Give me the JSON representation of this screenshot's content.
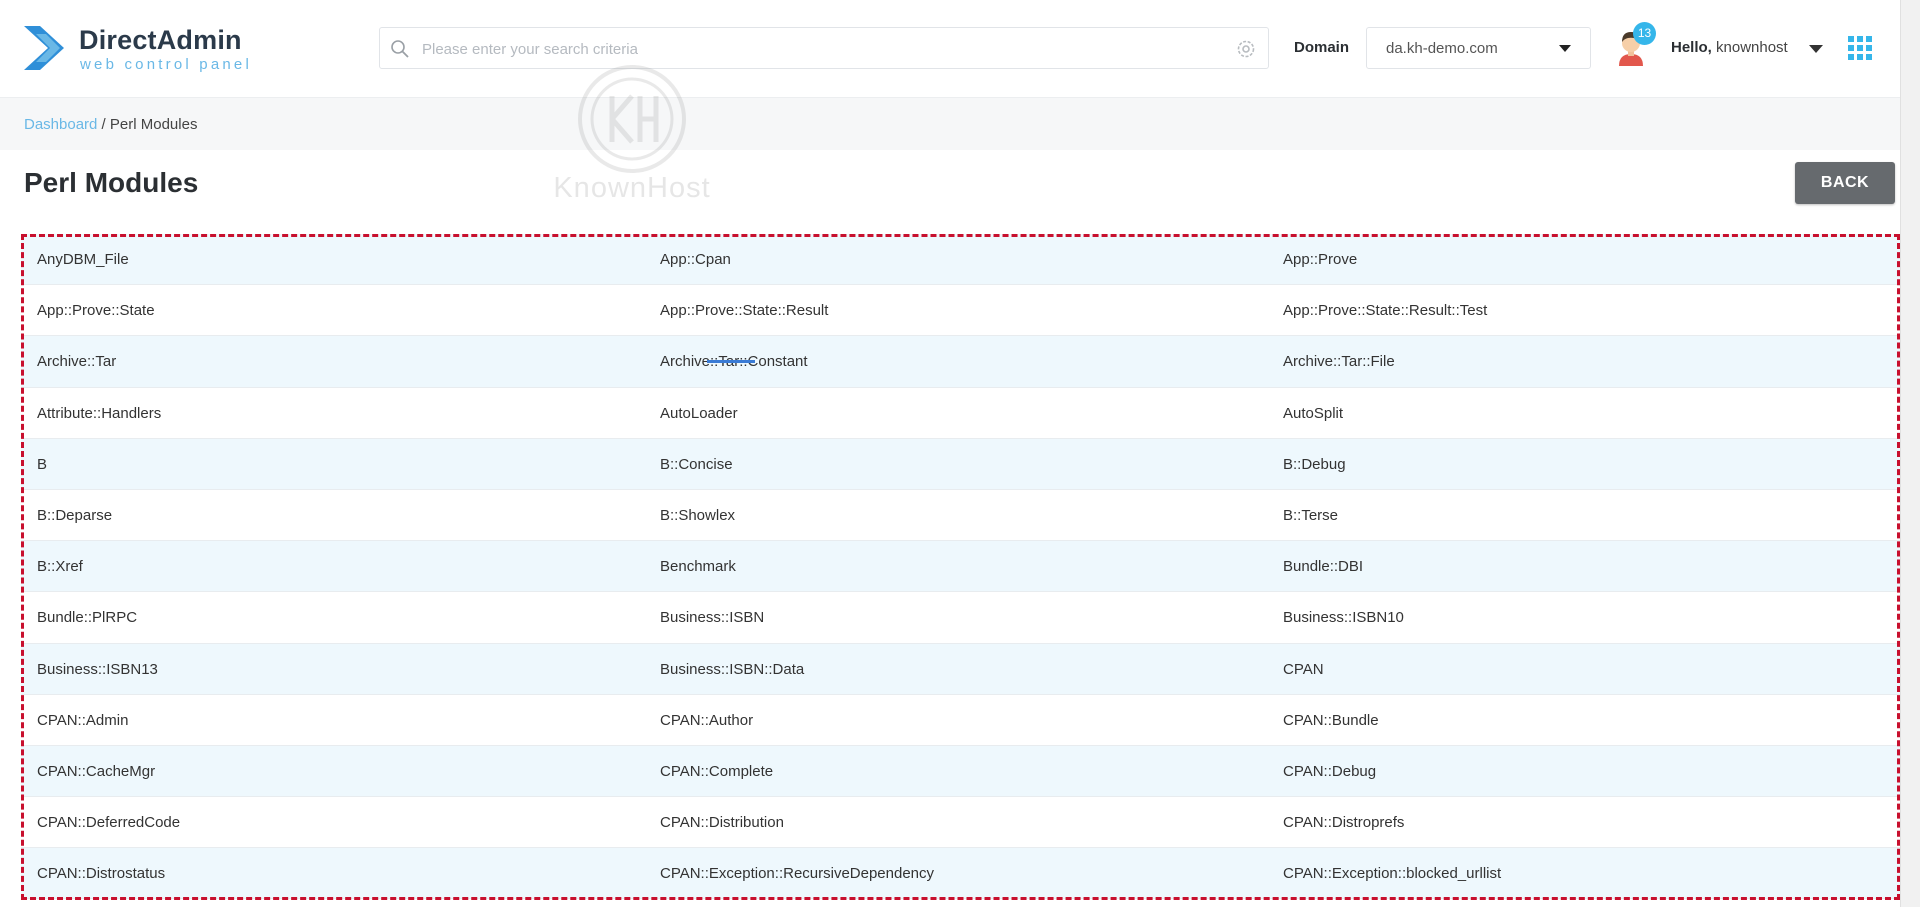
{
  "brand": {
    "name": "DirectAdmin",
    "tagline": "web control panel"
  },
  "search": {
    "placeholder": "Please enter your search criteria",
    "value": ""
  },
  "domain": {
    "label": "Domain",
    "selected": "da.kh-demo.com"
  },
  "user": {
    "greeting": "Hello,",
    "name": "knownhost",
    "notifications": "13"
  },
  "breadcrumb": {
    "home": "Dashboard",
    "separator": " / ",
    "current": "Perl Modules"
  },
  "watermark": {
    "text": "KnownHost"
  },
  "page": {
    "title": "Perl Modules",
    "back_label": "BACK"
  },
  "colors": {
    "accent": "#35b6ea",
    "highlight_border": "#c8102e",
    "row_alt": "#eef8fd",
    "back_button": "#666a6e"
  },
  "modules": [
    [
      "AnyDBM_File",
      "App::Cpan",
      "App::Prove"
    ],
    [
      "App::Prove::State",
      "App::Prove::State::Result",
      "App::Prove::State::Result::Test"
    ],
    [
      "Archive::Tar",
      "Archive::Tar::Constant",
      "Archive::Tar::File"
    ],
    [
      "Attribute::Handlers",
      "AutoLoader",
      "AutoSplit"
    ],
    [
      "B",
      "B::Concise",
      "B::Debug"
    ],
    [
      "B::Deparse",
      "B::Showlex",
      "B::Terse"
    ],
    [
      "B::Xref",
      "Benchmark",
      "Bundle::DBI"
    ],
    [
      "Bundle::PlRPC",
      "Business::ISBN",
      "Business::ISBN10"
    ],
    [
      "Business::ISBN13",
      "Business::ISBN::Data",
      "CPAN"
    ],
    [
      "CPAN::Admin",
      "CPAN::Author",
      "CPAN::Bundle"
    ],
    [
      "CPAN::CacheMgr",
      "CPAN::Complete",
      "CPAN::Debug"
    ],
    [
      "CPAN::DeferredCode",
      "CPAN::Distribution",
      "CPAN::Distroprefs"
    ],
    [
      "CPAN::Distrostatus",
      "CPAN::Exception::RecursiveDependency",
      "CPAN::Exception::blocked_urllist"
    ]
  ]
}
